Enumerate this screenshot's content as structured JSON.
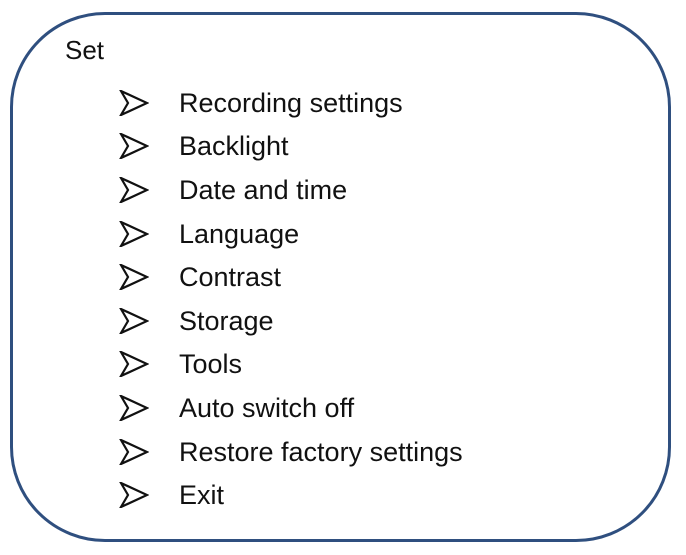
{
  "menu": {
    "title": "Set",
    "bullet_icon": "arrowhead-bullet-icon",
    "frame_color": "#2f4f7f",
    "items": [
      {
        "label": "Recording settings"
      },
      {
        "label": "Backlight"
      },
      {
        "label": "Date and time"
      },
      {
        "label": "Language"
      },
      {
        "label": "Contrast"
      },
      {
        "label": "Storage"
      },
      {
        "label": "Tools"
      },
      {
        "label": "Auto switch off"
      },
      {
        "label": "Restore factory settings"
      },
      {
        "label": "Exit"
      }
    ]
  }
}
